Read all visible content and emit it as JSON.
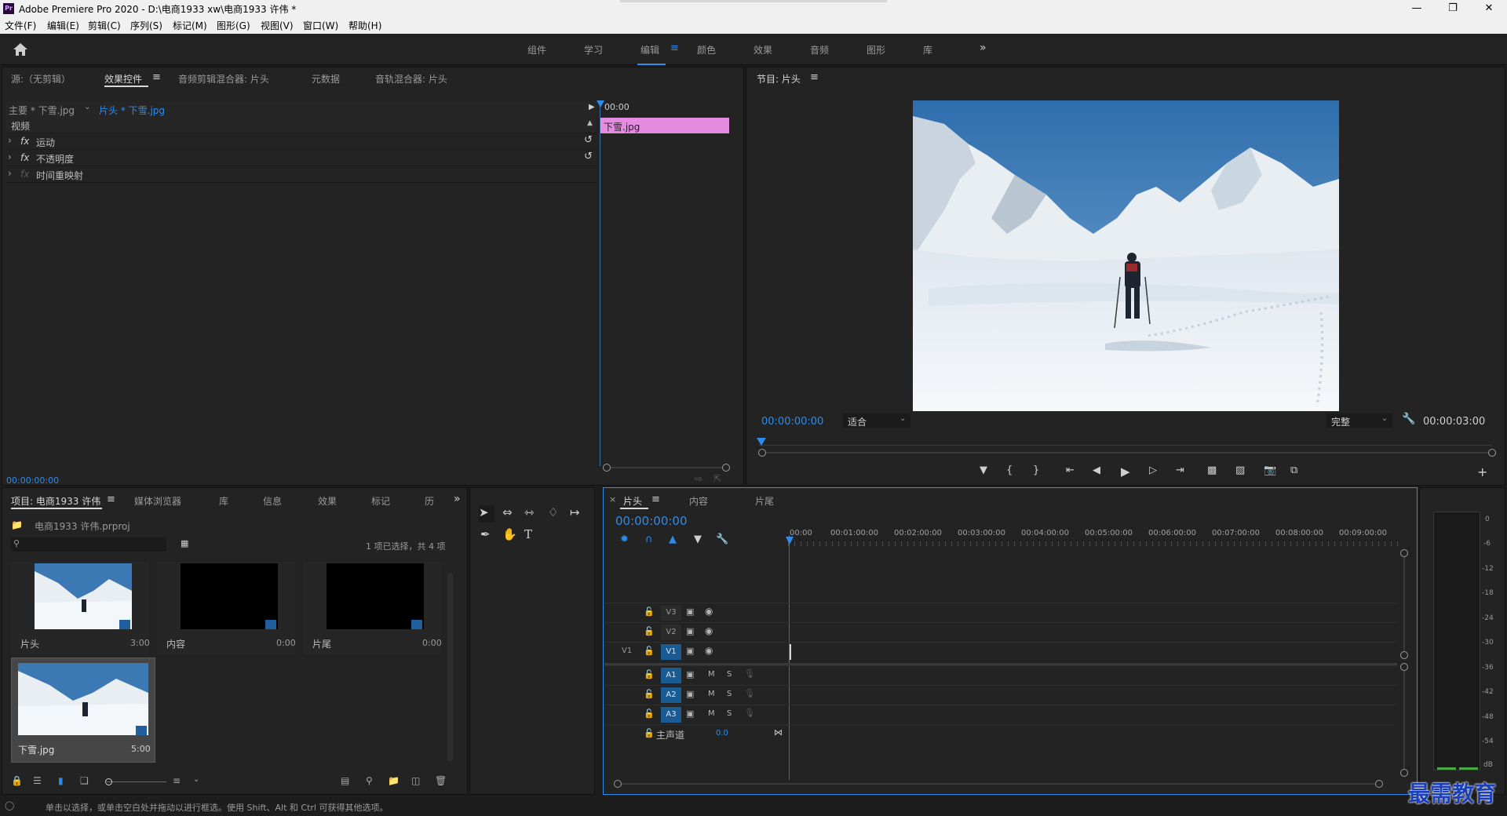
{
  "window": {
    "title": "Adobe Premiere Pro 2020 - D:\\电商1933 xw\\电商1933 许伟 *",
    "app_badge": "Pr"
  },
  "menu": [
    "文件(F)",
    "编辑(E)",
    "剪辑(C)",
    "序列(S)",
    "标记(M)",
    "图形(G)",
    "视图(V)",
    "窗口(W)",
    "帮助(H)"
  ],
  "workspaces": [
    "组件",
    "学习",
    "编辑",
    "颜色",
    "效果",
    "音频",
    "图形",
    "库"
  ],
  "source_panel": {
    "tabs": [
      "源:（无剪辑）",
      "效果控件",
      "音频剪辑混合器: 片头",
      "元数据",
      "音轨混合器: 片头"
    ],
    "master_clip": "主要 * 下雪.jpg",
    "sequence_clip": "片头 * 下雪.jpg",
    "section": "视频",
    "effects": [
      "运动",
      "不透明度",
      "时间重映射"
    ],
    "fx_label": "fx",
    "mini_timecode": "00:00",
    "clip_bar": "下雪.jpg",
    "timecode": "00:00:00:00"
  },
  "program": {
    "title": "节目: 片头",
    "timecode": "00:00:00:00",
    "fit": "适合",
    "quality": "完整",
    "duration": "00:00:03:00"
  },
  "project": {
    "tabs": [
      "项目: 电商1933 许伟",
      "媒体浏览器",
      "库",
      "信息",
      "效果",
      "标记",
      "历"
    ],
    "file": "电商1933 许伟.prproj",
    "selection": "1 项已选择，共 4 项",
    "items": [
      {
        "name": "片头",
        "duration": "3:00"
      },
      {
        "name": "内容",
        "duration": "0:00"
      },
      {
        "name": "片尾",
        "duration": "0:00"
      },
      {
        "name": "下雪.jpg",
        "duration": "5:00"
      }
    ]
  },
  "timeline": {
    "tabs": [
      "片头",
      "内容",
      "片尾"
    ],
    "timecode": "00:00:00:00",
    "ruler": [
      "00:00",
      "00:01:00:00",
      "00:02:00:00",
      "00:03:00:00",
      "00:04:00:00",
      "00:05:00:00",
      "00:06:00:00",
      "00:07:00:00",
      "00:08:00:00",
      "00:09:00:00"
    ],
    "video_tracks": [
      "V3",
      "V2",
      "V1"
    ],
    "audio_tracks": [
      "A1",
      "A2",
      "A3"
    ],
    "source_patch": "V1",
    "mute": "M",
    "solo": "S",
    "master": "主声道",
    "master_value": "0.0"
  },
  "meters": {
    "labels": [
      "0",
      "-6",
      "-12",
      "-18",
      "-24",
      "-30",
      "-36",
      "-42",
      "-48",
      "-54",
      "dB"
    ]
  },
  "status": "单击以选择，或单击空白处并拖动以进行框选。使用 Shift、Alt 和 Ctrl 可获得其他选项。",
  "watermark": "最需教育",
  "colors": {
    "accent": "#2d8ceb",
    "clip": "#e68ce0",
    "panel": "#232323",
    "bg": "#1d1d1d"
  }
}
